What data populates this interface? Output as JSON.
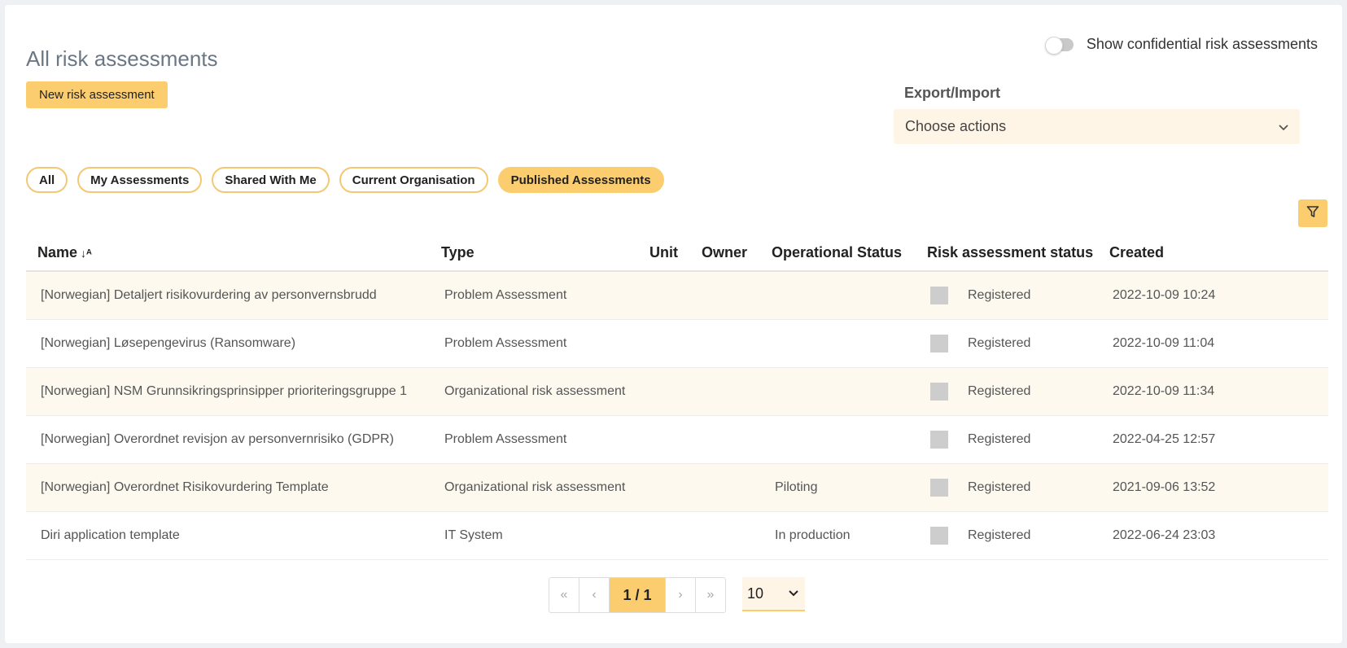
{
  "header": {
    "title": "All risk assessments",
    "toggle_label": "Show confidential risk assessments",
    "toggle_on": false
  },
  "actions": {
    "new_button": "New risk assessment",
    "export_label": "Export/Import",
    "export_select_value": "Choose actions"
  },
  "filters": {
    "pills": [
      {
        "label": "All",
        "active": false
      },
      {
        "label": "My Assessments",
        "active": false
      },
      {
        "label": "Shared With Me",
        "active": false
      },
      {
        "label": "Current Organisation",
        "active": false
      },
      {
        "label": "Published Assessments",
        "active": true
      }
    ]
  },
  "table": {
    "columns": [
      "Name",
      "Type",
      "Unit",
      "Owner",
      "Operational Status",
      "Risk assessment status",
      "Created"
    ],
    "rows": [
      {
        "name": "[Norwegian] Detaljert risikovurdering av personvernsbrudd",
        "type": "Problem Assessment",
        "unit": "",
        "owner": "",
        "op_status": "",
        "status": "Registered",
        "created": "2022-10-09 10:24"
      },
      {
        "name": "[Norwegian] Løsepengevirus (Ransomware)",
        "type": "Problem Assessment",
        "unit": "",
        "owner": "",
        "op_status": "",
        "status": "Registered",
        "created": "2022-10-09 11:04"
      },
      {
        "name": "[Norwegian] NSM Grunnsikringsprinsipper prioriteringsgruppe 1",
        "type": "Organizational risk assessment",
        "unit": "",
        "owner": "",
        "op_status": "",
        "status": "Registered",
        "created": "2022-10-09 11:34"
      },
      {
        "name": "[Norwegian] Overordnet revisjon av personvernrisiko (GDPR)",
        "type": "Problem Assessment",
        "unit": "",
        "owner": "",
        "op_status": "",
        "status": "Registered",
        "created": "2022-04-25 12:57"
      },
      {
        "name": "[Norwegian] Overordnet Risikovurdering Template",
        "type": "Organizational risk assessment",
        "unit": "",
        "owner": "",
        "op_status": "Piloting",
        "status": "Registered",
        "created": "2021-09-06 13:52"
      },
      {
        "name": "Diri application template",
        "type": "IT System",
        "unit": "",
        "owner": "",
        "op_status": "In production",
        "status": "Registered",
        "created": "2022-06-24 23:03"
      }
    ]
  },
  "pagination": {
    "first": "«",
    "prev": "‹",
    "current": "1 / 1",
    "next": "›",
    "last": "»",
    "page_size": "10"
  },
  "icons": {
    "filter": "filter-icon",
    "sort": "sort-alpha-icon",
    "chevron": "chevron-down-icon"
  },
  "colors": {
    "accent": "#fbcd6f",
    "row_stripe": "#fdf9ef",
    "select_bg": "#fff5e6"
  }
}
